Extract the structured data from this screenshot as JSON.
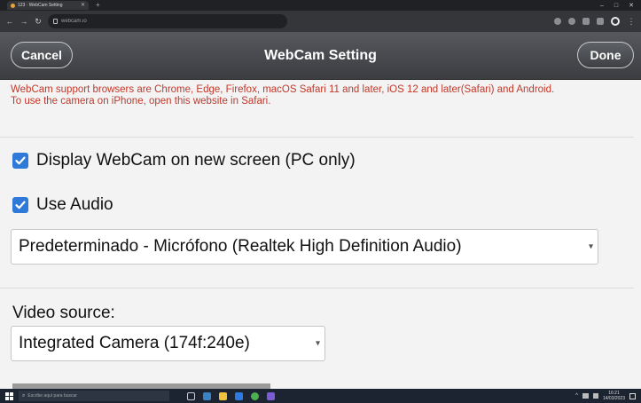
{
  "browser": {
    "tab_title": "123 · WebCam Setting",
    "url": "webcam.io",
    "win_controls": [
      "–",
      "□",
      "✕"
    ]
  },
  "appbar": {
    "title": "WebCam Setting",
    "cancel_label": "Cancel",
    "done_label": "Done"
  },
  "notice": {
    "line1": "WebCam support browsers are Chrome, Edge, Firefox, macOS Safari 11 and later, iOS 12 and later(Safari) and Android.",
    "line2": "To use the camera on iPhone, open this website in Safari."
  },
  "options": {
    "display_webcam": {
      "label": "Display WebCam on new screen (PC only)",
      "checked": true
    },
    "use_audio": {
      "label": "Use Audio",
      "checked": true
    }
  },
  "audio_select": {
    "value": "Predeterminado - Micrófono (Realtek High Definition Audio)"
  },
  "video": {
    "label": "Video source:",
    "select_value": "Integrated Camera (174f:240e)"
  },
  "taskbar": {
    "search_placeholder": "Escribe aquí para buscar",
    "time": "16:21",
    "date": "14/03/2023"
  },
  "colors": {
    "notice_red": "#c0392b",
    "checkbox_blue": "#2f7ad8",
    "header_dark": "#3b3d41"
  }
}
